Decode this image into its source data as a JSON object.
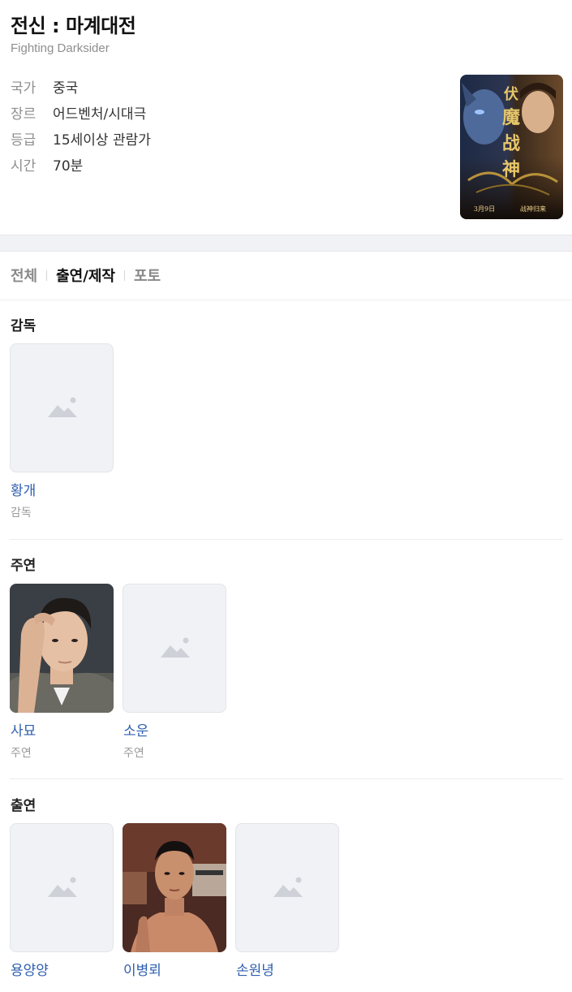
{
  "movie": {
    "title": "전신 : 마계대전",
    "subtitle": "Fighting Darksider",
    "info": [
      {
        "key": "국가",
        "value": "중국"
      },
      {
        "key": "장르",
        "value": "어드벤처/시대극"
      },
      {
        "key": "등급",
        "value": "15세이상 관람가"
      },
      {
        "key": "시간",
        "value": "70분"
      }
    ],
    "poster_text": {
      "caption_left": "3月9日",
      "caption_right": "战神归来",
      "title_glyphs": "伏魔战神"
    }
  },
  "tabs": [
    {
      "label": "전체",
      "active": false
    },
    {
      "label": "출연/제작",
      "active": true
    },
    {
      "label": "포토",
      "active": false
    }
  ],
  "sections": {
    "director": {
      "title": "감독",
      "people": [
        {
          "name": "황개",
          "role": "감독",
          "photo": "placeholder"
        }
      ]
    },
    "lead": {
      "title": "주연",
      "people": [
        {
          "name": "사묘",
          "role": "주연",
          "photo": "portrait"
        },
        {
          "name": "소운",
          "role": "주연",
          "photo": "placeholder"
        }
      ]
    },
    "cast": {
      "title": "출연",
      "people": [
        {
          "name": "용양양",
          "photo": "placeholder"
        },
        {
          "name": "이병뢰",
          "photo": "portrait"
        },
        {
          "name": "손원녕",
          "photo": "placeholder"
        }
      ]
    }
  },
  "icons": {
    "placeholder": "image-placeholder-icon"
  },
  "colors": {
    "link": "#2f5fb0",
    "muted": "#8e8e8e",
    "band": "#f1f2f6"
  }
}
